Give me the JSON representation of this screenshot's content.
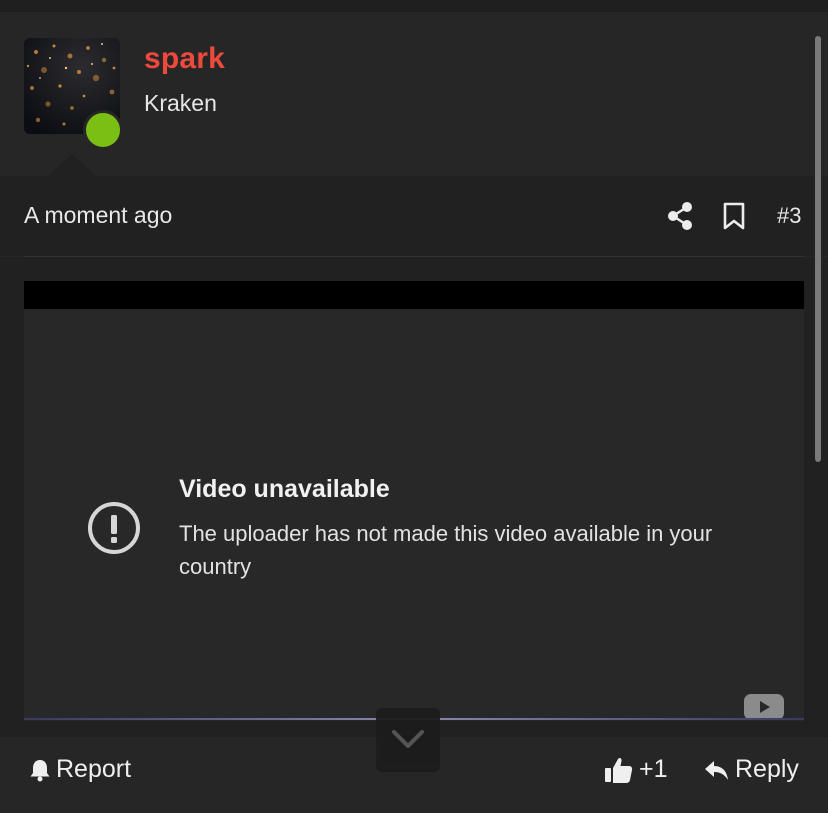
{
  "post": {
    "username": "spark",
    "rank": "Kraken",
    "online": true,
    "timestamp": "A moment ago",
    "post_number": "#3"
  },
  "video": {
    "title": "Video unavailable",
    "message": "The uploader has not made this video available in your country"
  },
  "footer": {
    "report_label": "Report",
    "like_count": "+1",
    "reply_label": "Reply"
  },
  "colors": {
    "username": "#ee4a3c",
    "online_indicator": "#7bbf14",
    "background": "#262627"
  },
  "icons": [
    "share-icon",
    "bookmark-icon",
    "warning-icon",
    "youtube-icon",
    "bell-icon",
    "thumbs-up-icon",
    "reply-arrow-icon",
    "chevron-down-icon"
  ]
}
